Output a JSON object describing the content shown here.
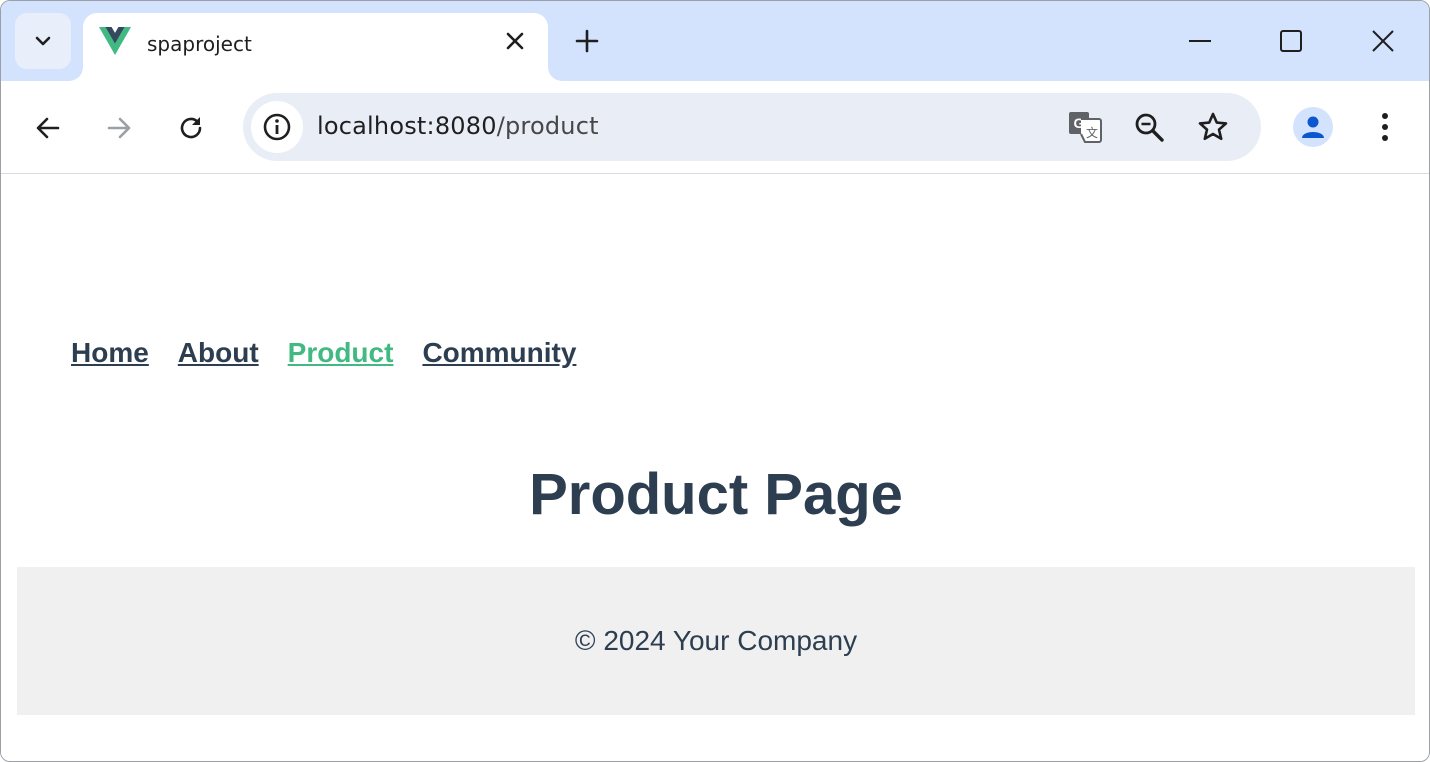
{
  "browser": {
    "tab": {
      "title": "spaproject"
    },
    "address_bar": {
      "host": "localhost:8080",
      "path": "/product"
    },
    "colors": {
      "tabstrip": "#d3e3fd",
      "omnibox": "#e9eef6",
      "profile_icon": "#0b57d0"
    },
    "icons": [
      "tab-search-icon",
      "vue-logo-icon",
      "close-icon",
      "plus-icon",
      "minimize-icon",
      "maximize-icon",
      "window-close-icon",
      "back-icon",
      "forward-icon",
      "reload-icon",
      "site-info-icon",
      "translate-icon",
      "zoom-icon",
      "bookmark-star-icon",
      "profile-icon",
      "more-menu-icon"
    ]
  },
  "page": {
    "nav": [
      {
        "label": "Home",
        "active": false
      },
      {
        "label": "About",
        "active": false
      },
      {
        "label": "Product",
        "active": true
      },
      {
        "label": "Community",
        "active": false
      }
    ],
    "title": "Product Page",
    "footer": "© 2024 Your Company",
    "colors": {
      "text": "#2c3e50",
      "active_link": "#42b983",
      "footer_bg": "#f0f0f0"
    }
  }
}
